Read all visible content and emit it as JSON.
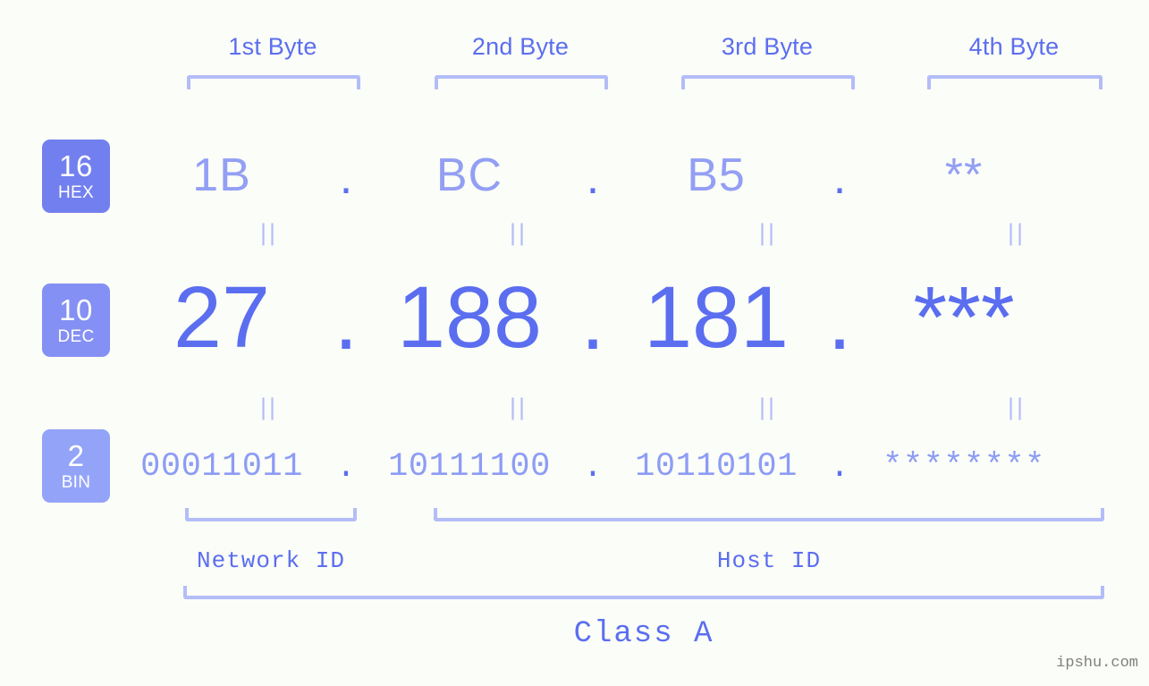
{
  "page": {
    "background_color": "#fbfdf8",
    "accent_color": "#5b6ef0",
    "muted_accent_color": "#8d9cf5",
    "bracket_color": "#b3bdf8",
    "watermark": "ipshu.com"
  },
  "byte_headers": [
    {
      "label": "1st Byte"
    },
    {
      "label": "2nd Byte"
    },
    {
      "label": "3rd Byte"
    },
    {
      "label": "4th Byte"
    }
  ],
  "bases": [
    {
      "number": "16",
      "name": "HEX",
      "color": "#7280ef"
    },
    {
      "number": "10",
      "name": "DEC",
      "color": "#8490f3"
    },
    {
      "number": "2",
      "name": "BIN",
      "color": "#93a4f8"
    }
  ],
  "rows": {
    "hex": {
      "values": [
        "1B",
        "BC",
        "B5",
        "**"
      ],
      "separator": "."
    },
    "dec": {
      "values": [
        "27",
        "188",
        "181",
        "***"
      ],
      "separator": "."
    },
    "bin": {
      "values": [
        "00011011",
        "10111100",
        "10110101",
        "********"
      ],
      "separator": "."
    }
  },
  "equality_marks": {
    "glyph": "||",
    "count_per_row": 4
  },
  "id_sections": [
    {
      "label": "Network ID"
    },
    {
      "label": "Host ID"
    }
  ],
  "class": {
    "label": "Class A"
  }
}
